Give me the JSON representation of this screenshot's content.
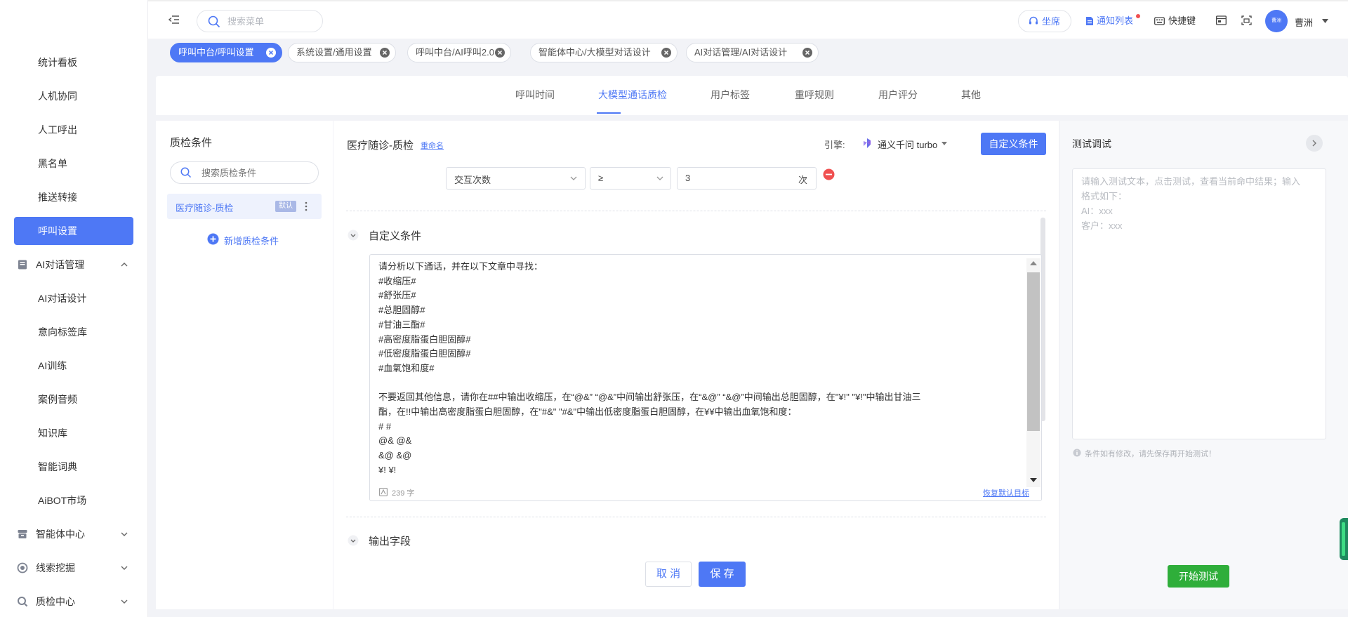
{
  "sidebar": {
    "items": [
      {
        "label": "统计看板"
      },
      {
        "label": "人机协同"
      },
      {
        "label": "人工呼出"
      },
      {
        "label": "黑名单"
      },
      {
        "label": "推送转接"
      },
      {
        "label": "呼叫设置"
      }
    ],
    "ai_group": {
      "label": "AI对话管理"
    },
    "ai_items": [
      {
        "label": "AI对话设计"
      },
      {
        "label": "意向标签库"
      },
      {
        "label": "AI训练"
      },
      {
        "label": "案例音频"
      },
      {
        "label": "知识库"
      },
      {
        "label": "智能词典"
      },
      {
        "label": "AiBOT市场"
      }
    ],
    "groups": [
      {
        "label": "智能体中心"
      },
      {
        "label": "线索挖掘"
      },
      {
        "label": "质检中心"
      }
    ]
  },
  "header": {
    "search_placeholder": "搜索菜单",
    "seat": "坐席",
    "notify": "通知列表",
    "shortcut": "快捷键",
    "user": "曹洲",
    "avatar_text": "曹洲"
  },
  "tags": [
    {
      "label": "呼叫中台/呼叫设置"
    },
    {
      "label": "系统设置/通用设置"
    },
    {
      "label": "呼叫中台/AI呼叫2.0"
    },
    {
      "label": "智能体中心/大模型对话设计"
    },
    {
      "label": "AI对话管理/AI对话设计"
    }
  ],
  "subnav": [
    {
      "label": "呼叫时间"
    },
    {
      "label": "大模型通话质检"
    },
    {
      "label": "用户标签"
    },
    {
      "label": "重呼规则"
    },
    {
      "label": "用户评分"
    },
    {
      "label": "其他"
    }
  ],
  "left_panel": {
    "title": "质检条件",
    "search_placeholder": "搜索质检条件",
    "item": "医疗随诊-质检",
    "badge": "默认",
    "add": "新增质检条件"
  },
  "main": {
    "title": "医疗随诊-质检",
    "rename": "重命名",
    "engine_label": "引擎:",
    "engine_value": "通义千问 turbo",
    "custom_btn": "自定义条件",
    "cond_field": "交互次数",
    "cond_op": "≥",
    "cond_value": "3",
    "cond_unit": "次",
    "custom_section": "自定义条件",
    "text_lines": [
      "请分析以下通话，并在以下文章中寻找：",
      "#收缩压#",
      "#舒张压#",
      "#总胆固醇#",
      "#甘油三酯#",
      "#高密度脂蛋白胆固醇#",
      "#低密度脂蛋白胆固醇#",
      "#血氧饱和度#",
      "",
      "不要返回其他信息，请你在##中输出收缩压，在“@&” “@&”中间输出舒张压，在“&@” “&@”中间输出总胆固醇，在\"¥!\" \"¥!\"中输出甘油三",
      "酯，在!!中输出高密度脂蛋白胆固醇，在\"#&\" \"#&\"中输出低密度脂蛋白胆固醇，在¥¥中输出血氧饱和度：",
      "# #",
      "@& @&",
      "&@ &@",
      "¥! ¥!"
    ],
    "char_count": "239 字",
    "restore": "恢复默认目标",
    "output_section": "输出字段",
    "cancel": "取 消",
    "save": "保 存"
  },
  "test_panel": {
    "title": "测试调试",
    "placeholder_lines": [
      "请输入测试文本，点击测试，查看当前命中结果；输入",
      "格式如下：",
      "AI：xxx",
      "客户：xxx"
    ],
    "tip": "条件如有修改，请先保存再开始测试！",
    "start": "开始测试"
  },
  "colors": {
    "primary": "#4e78f5",
    "green": "#2fae3a",
    "danger": "#f05050"
  }
}
